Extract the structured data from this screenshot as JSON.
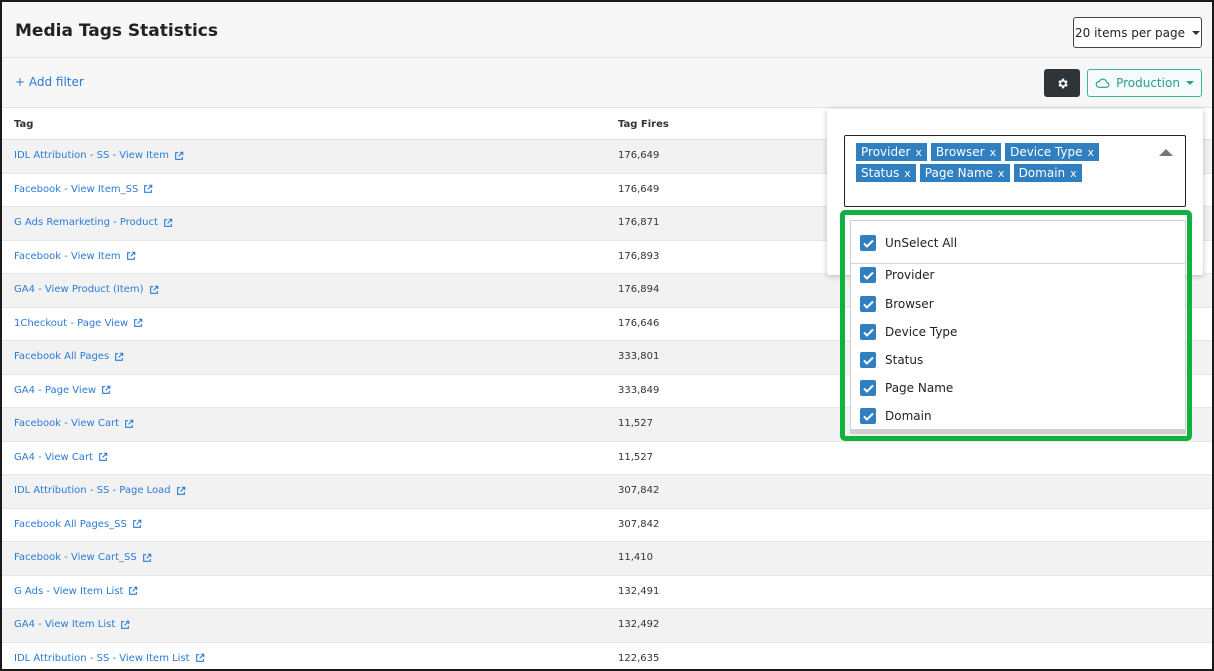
{
  "header": {
    "title": "Media Tags Statistics",
    "items_per_page": "20 items per page"
  },
  "filterbar": {
    "add_filter": "+ Add filter",
    "environment": "Production"
  },
  "table": {
    "columns": [
      "Tag",
      "Tag Fires"
    ],
    "rows": [
      {
        "tag": "IDL Attribution - SS - View Item",
        "fires": "176,649"
      },
      {
        "tag": "Facebook - View Item_SS",
        "fires": "176,649"
      },
      {
        "tag": "G Ads Remarketing - Product",
        "fires": "176,871"
      },
      {
        "tag": "Facebook - View Item",
        "fires": "176,893"
      },
      {
        "tag": "GA4 - View Product (Item)",
        "fires": "176,894"
      },
      {
        "tag": "1Checkout - Page View",
        "fires": "176,646"
      },
      {
        "tag": "Facebook All Pages",
        "fires": "333,801"
      },
      {
        "tag": "GA4 - Page View",
        "fires": "333,849"
      },
      {
        "tag": "Facebook - View Cart",
        "fires": "11,527"
      },
      {
        "tag": "GA4 - View Cart",
        "fires": "11,527"
      },
      {
        "tag": "IDL Attribution - SS - Page Load",
        "fires": "307,842"
      },
      {
        "tag": "Facebook All Pages_SS",
        "fires": "307,842"
      },
      {
        "tag": "Facebook - View Cart_SS",
        "fires": "11,410"
      },
      {
        "tag": "G Ads - View Item List",
        "fires": "132,491"
      },
      {
        "tag": "GA4 - View Item List",
        "fires": "132,492"
      },
      {
        "tag": "IDL Attribution - SS - View Item List",
        "fires": "122,635"
      }
    ]
  },
  "column_picker": {
    "chips": [
      "Provider",
      "Browser",
      "Device Type",
      "Status",
      "Page Name",
      "Domain"
    ],
    "chip_remove": "x",
    "unselect_all": "UnSelect All",
    "options": [
      "Provider",
      "Browser",
      "Device Type",
      "Status",
      "Page Name",
      "Domain"
    ]
  },
  "colors": {
    "link": "#2a7bd6",
    "chip": "#2f7fc1",
    "highlight": "#10b141",
    "production": "#2a9d8f"
  }
}
